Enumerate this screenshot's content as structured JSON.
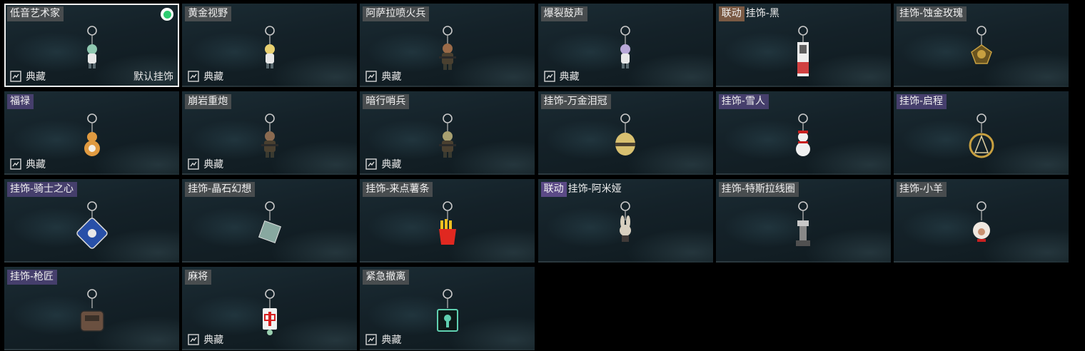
{
  "colors": {
    "card_background": "#142128",
    "selected_border": "#f2f2f2",
    "equipped_dot": "#2ecc71",
    "collab_brown": "#7a5a44",
    "collab_purple": "#5b4a86",
    "name_gray": "#5c5c5c",
    "name_purple": "#584884"
  },
  "labels": {
    "collection": "典藏",
    "default": "默认挂饰"
  },
  "items": [
    {
      "name": "低音艺术家",
      "tag_style": "gray",
      "selected": true,
      "equipped": true,
      "collection": true,
      "default": true,
      "charm": "mini-figure-icon",
      "accent": "#8fc8b0"
    },
    {
      "name": "黄金视野",
      "tag_style": "gray",
      "collection": true,
      "charm": "mini-figure-icon",
      "accent": "#e8d070"
    },
    {
      "name": "阿萨拉喷火兵",
      "tag_style": "gray",
      "collection": true,
      "charm": "soldier-figure-icon",
      "accent": "#9a6a48"
    },
    {
      "name": "爆裂鼓声",
      "tag_style": "gray",
      "collection": true,
      "charm": "mini-figure-icon",
      "accent": "#b8a8d8"
    },
    {
      "name": "挂饰-黑",
      "collab": "联动",
      "collab_style": "brown",
      "tag_style": "plain",
      "charm": "card-tag-icon",
      "accent": "#d04040"
    },
    {
      "name": "挂饰-蚀金玫瑰",
      "tag_style": "gray",
      "charm": "rose-emblem-icon",
      "accent": "#c8a040"
    },
    {
      "name": "福禄",
      "tag_style": "purple",
      "collection": true,
      "charm": "gourd-icon",
      "accent": "#e09a40"
    },
    {
      "name": "崩岩重炮",
      "tag_style": "gray",
      "collection": true,
      "charm": "soldier-figure-icon",
      "accent": "#8a6a50"
    },
    {
      "name": "暗行哨兵",
      "tag_style": "gray",
      "collection": true,
      "charm": "soldier-figure-icon",
      "accent": "#a8a070"
    },
    {
      "name": "挂饰-万金泪冠",
      "tag_style": "gray",
      "charm": "crown-icon",
      "accent": "#d8c070"
    },
    {
      "name": "挂饰-雪人",
      "tag_style": "purple",
      "charm": "snowman-icon",
      "accent": "#f0f0f0"
    },
    {
      "name": "挂饰-启程",
      "tag_style": "purple",
      "charm": "compass-ring-icon",
      "accent": "#c8a040"
    },
    {
      "name": "挂饰-骑士之心",
      "tag_style": "purple",
      "charm": "shield-emblem-icon",
      "accent": "#2850a8"
    },
    {
      "name": "挂饰-晶石幻想",
      "tag_style": "gray",
      "charm": "crystal-cube-icon",
      "accent": "#88a8a0"
    },
    {
      "name": "挂饰-来点薯条",
      "tag_style": "gray",
      "charm": "fries-box-icon",
      "accent": "#e02820"
    },
    {
      "name": "挂饰-阿米娅",
      "collab": "联动",
      "collab_style": "purple",
      "tag_style": "plain",
      "charm": "bunny-figure-icon",
      "accent": "#d8d0c0"
    },
    {
      "name": "挂饰-特斯拉线圈",
      "tag_style": "gray",
      "charm": "tesla-coil-icon",
      "accent": "#c8c8c8"
    },
    {
      "name": "挂饰-小羊",
      "tag_style": "gray",
      "charm": "sheep-figure-icon",
      "accent": "#f0e8e0"
    },
    {
      "name": "挂饰-枪匠",
      "tag_style": "purple",
      "charm": "backpack-icon",
      "accent": "#6a5040"
    },
    {
      "name": "麻将",
      "tag_style": "gray",
      "collection": true,
      "charm": "mahjong-tile-icon",
      "accent": "#d82020"
    },
    {
      "name": "紧急撤离",
      "tag_style": "gray",
      "collection": true,
      "charm": "glowing-cube-icon",
      "accent": "#60d0b0"
    }
  ]
}
